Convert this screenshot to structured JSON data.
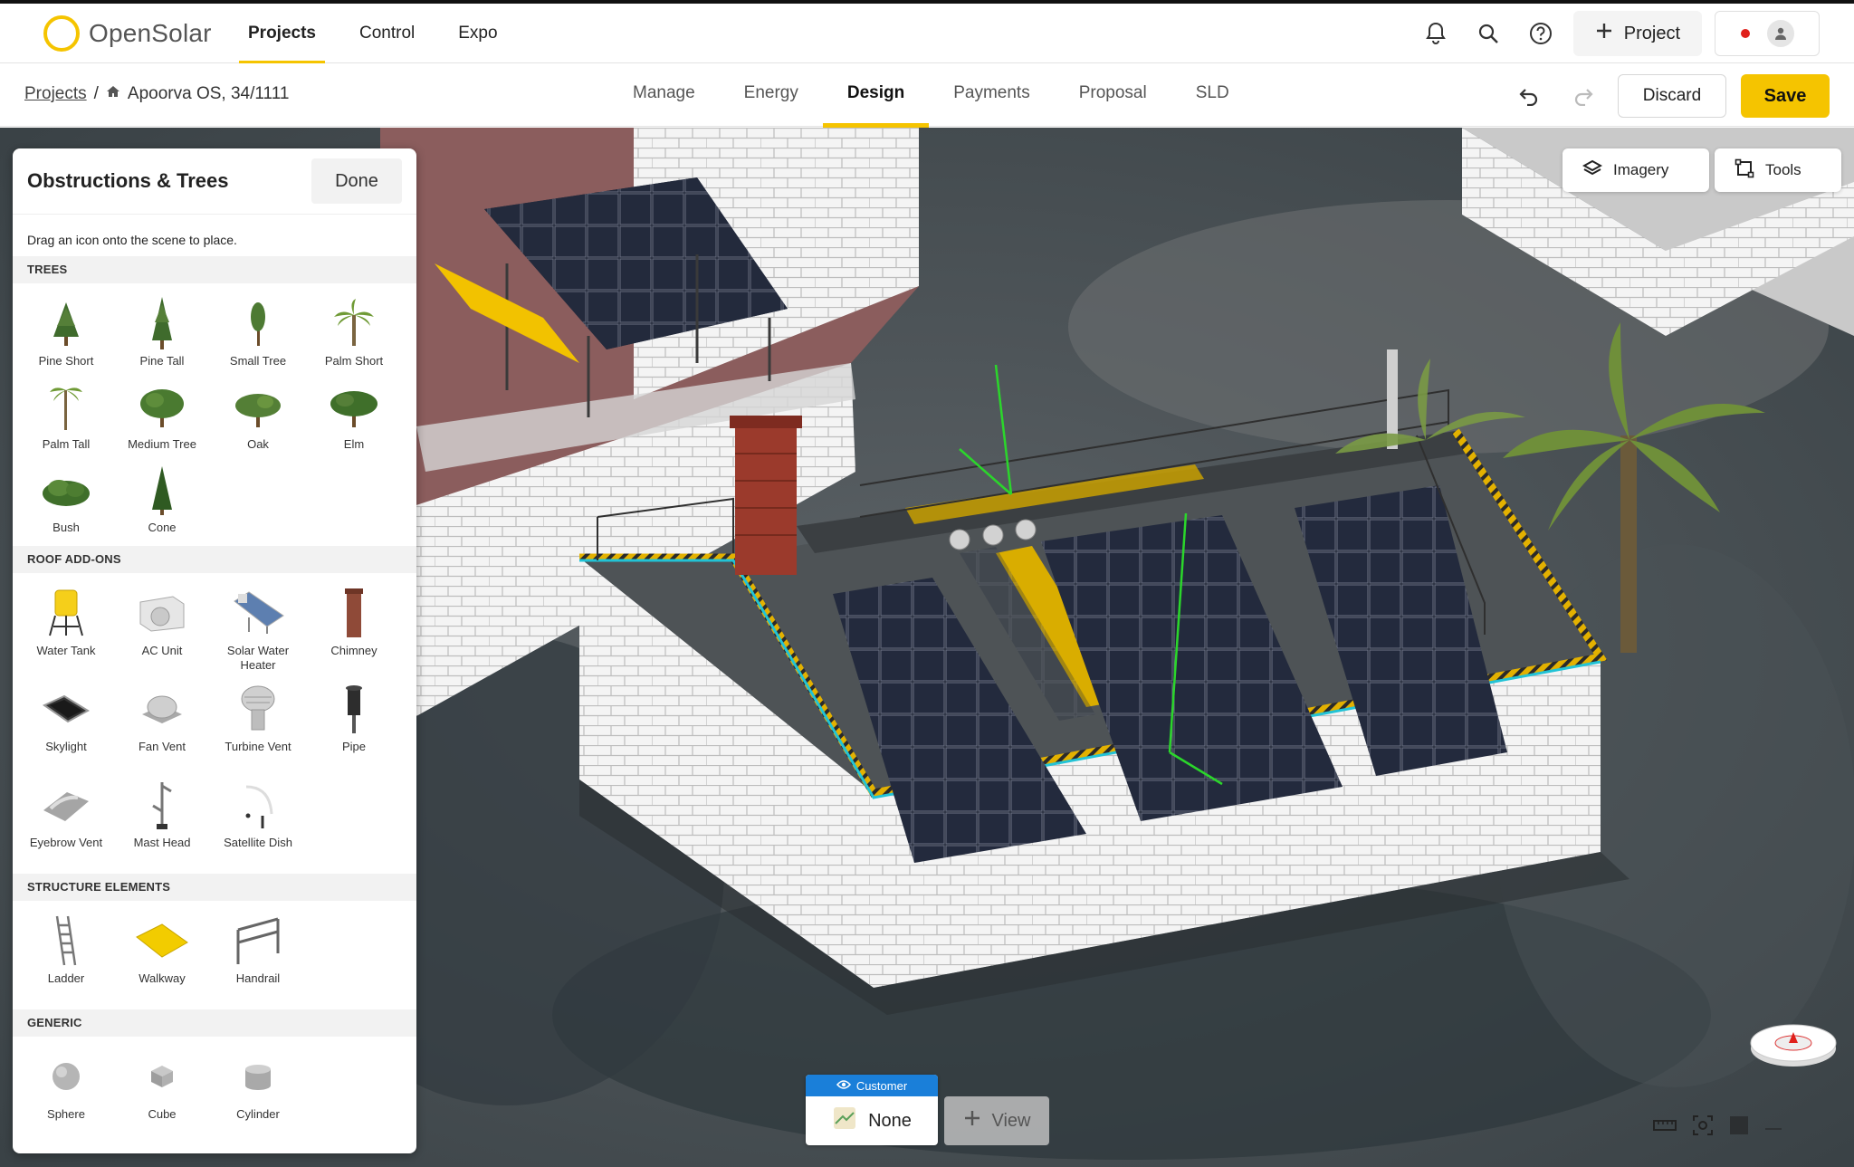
{
  "app": {
    "name": "OpenSolar"
  },
  "main_nav": [
    {
      "label": "Projects",
      "active": true
    },
    {
      "label": "Control",
      "active": false
    },
    {
      "label": "Expo",
      "active": false
    }
  ],
  "top_actions": {
    "new_project_label": "Project",
    "notification_icon": "bell-icon",
    "search_icon": "search-icon",
    "help_icon": "help-icon"
  },
  "breadcrumb": {
    "root": "Projects",
    "separator": "/",
    "current": "Apoorva OS, 34/1111"
  },
  "tabs": [
    {
      "label": "Manage",
      "active": false
    },
    {
      "label": "Energy",
      "active": false
    },
    {
      "label": "Design",
      "active": true
    },
    {
      "label": "Payments",
      "active": false
    },
    {
      "label": "Proposal",
      "active": false
    },
    {
      "label": "SLD",
      "active": false
    }
  ],
  "toolbar": {
    "discard_label": "Discard",
    "save_label": "Save"
  },
  "panel": {
    "title": "Obstructions & Trees",
    "done_label": "Done",
    "hint": "Drag an icon onto the scene to place.",
    "sections": [
      {
        "title": "TREES",
        "items": [
          "Pine Short",
          "Pine Tall",
          "Small Tree",
          "Palm Short",
          "Palm Tall",
          "Medium Tree",
          "Oak",
          "Elm",
          "Bush",
          "Cone"
        ]
      },
      {
        "title": "ROOF ADD-ONS",
        "items": [
          "Water Tank",
          "AC Unit",
          "Solar Water Heater",
          "Chimney",
          "Skylight",
          "Fan Vent",
          "Turbine Vent",
          "Pipe",
          "Eyebrow Vent",
          "Mast Head",
          "Satellite Dish"
        ]
      },
      {
        "title": "STRUCTURE ELEMENTS",
        "items": [
          "Ladder",
          "Walkway",
          "Handrail"
        ]
      },
      {
        "title": "GENERIC",
        "items": [
          "Sphere",
          "Cube",
          "Cylinder"
        ]
      }
    ]
  },
  "map_controls": {
    "imagery_label": "Imagery",
    "tools_label": "Tools"
  },
  "view_selector": {
    "badge": "Customer",
    "current": "None",
    "add_label": "View"
  },
  "colors": {
    "accent": "#f5c400",
    "badge_blue": "#1a7fd9",
    "roof_edge": "#22c3d6"
  }
}
